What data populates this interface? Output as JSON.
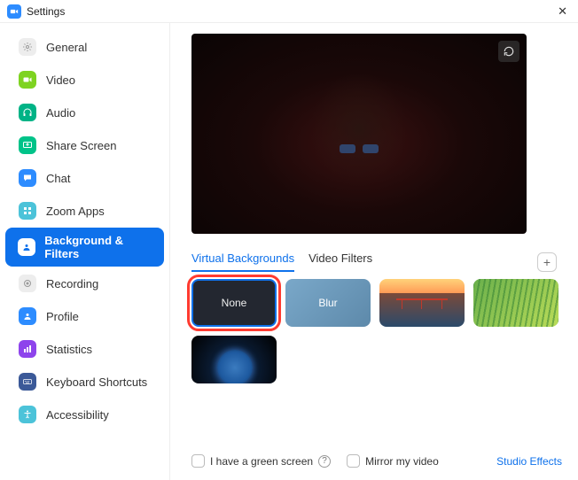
{
  "window": {
    "title": "Settings"
  },
  "sidebar": {
    "items": [
      {
        "label": "General"
      },
      {
        "label": "Video"
      },
      {
        "label": "Audio"
      },
      {
        "label": "Share Screen"
      },
      {
        "label": "Chat"
      },
      {
        "label": "Zoom Apps"
      },
      {
        "label": "Background & Filters"
      },
      {
        "label": "Recording"
      },
      {
        "label": "Profile"
      },
      {
        "label": "Statistics"
      },
      {
        "label": "Keyboard Shortcuts"
      },
      {
        "label": "Accessibility"
      }
    ],
    "active_index": 6
  },
  "tabs": {
    "virtual_backgrounds": "Virtual Backgrounds",
    "video_filters": "Video Filters",
    "active": "virtual_backgrounds"
  },
  "backgrounds": {
    "none_label": "None",
    "blur_label": "Blur",
    "selected": "none",
    "options": [
      "none",
      "blur",
      "golden-gate",
      "grass",
      "earth"
    ]
  },
  "footer": {
    "green_screen": "I have a green screen",
    "mirror": "Mirror my video",
    "studio_effects": "Studio Effects"
  },
  "icons": {
    "close": "✕",
    "plus": "+",
    "help": "?"
  }
}
